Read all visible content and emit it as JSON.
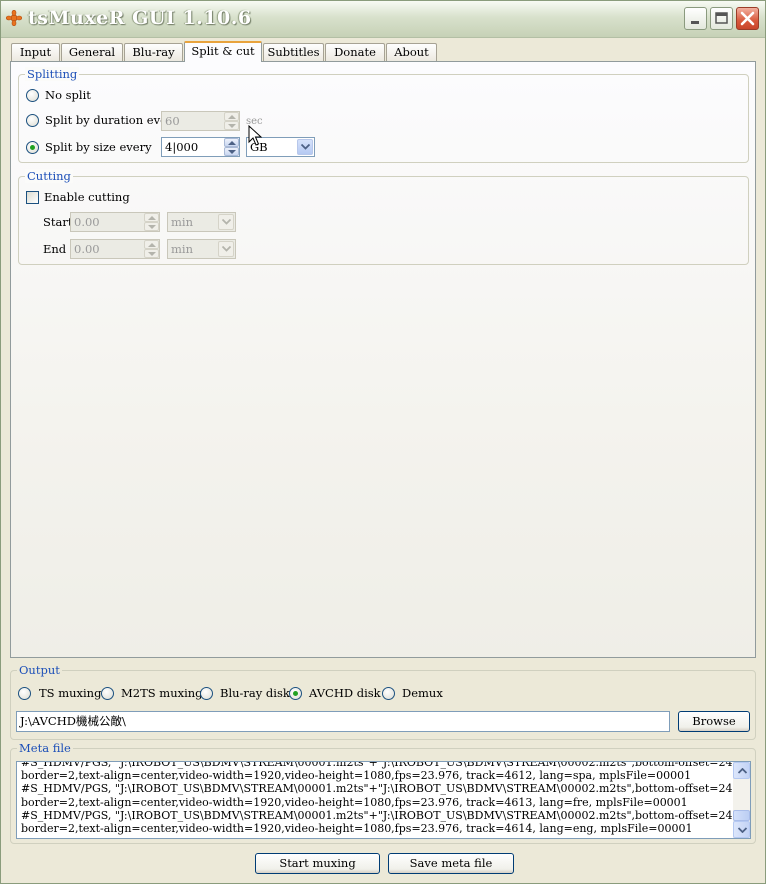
{
  "window": {
    "title": "tsMuxeR GUI 1.10.6",
    "controls": [
      "minimize-icon",
      "maximize-icon",
      "close-icon"
    ]
  },
  "tabs": [
    {
      "label": "Input",
      "active": false
    },
    {
      "label": "General",
      "active": false
    },
    {
      "label": "Blu-ray",
      "active": false
    },
    {
      "label": "Split & cut",
      "active": true
    },
    {
      "label": "Subtitles",
      "active": false
    },
    {
      "label": "Donate",
      "active": false
    },
    {
      "label": "About",
      "active": false
    }
  ],
  "splitting": {
    "legend": "Splitting",
    "no_split": "No split",
    "by_duration": "Split by duration every",
    "duration_value": "60",
    "duration_unit": "sec",
    "by_size": "Split by size every",
    "size_value": "4|000",
    "size_unit": "GB",
    "selected": "by_size"
  },
  "cutting": {
    "legend": "Cutting",
    "enable": "Enable cutting",
    "enabled": false,
    "start_label": "Start",
    "start_value": "0.00",
    "start_unit": "min",
    "end_label": "End",
    "end_value": "0.00",
    "end_unit": "min"
  },
  "output": {
    "legend": "Output",
    "options": [
      "TS muxing",
      "M2TS muxing",
      "Blu-ray disk",
      "AVCHD disk",
      "Demux"
    ],
    "selected": "AVCHD disk",
    "path": "J:\\AVCHD機械公敵\\",
    "browse": "Browse"
  },
  "meta": {
    "legend": "Meta file",
    "text": "#S_HDMV/PGS, \"J:\\IROBOT_US\\BDMV\\STREAM\\00001.m2ts\"+\"J:\\IROBOT_US\\BDMV\\STREAM\\00002.m2ts\",bottom-offset=24,font-\nborder=2,text-align=center,video-width=1920,video-height=1080,fps=23.976, track=4612, lang=spa, mplsFile=00001\n#S_HDMV/PGS, \"J:\\IROBOT_US\\BDMV\\STREAM\\00001.m2ts\"+\"J:\\IROBOT_US\\BDMV\\STREAM\\00002.m2ts\",bottom-offset=24,font-\nborder=2,text-align=center,video-width=1920,video-height=1080,fps=23.976, track=4613, lang=fre, mplsFile=00001\n#S_HDMV/PGS, \"J:\\IROBOT_US\\BDMV\\STREAM\\00001.m2ts\"+\"J:\\IROBOT_US\\BDMV\\STREAM\\00002.m2ts\",bottom-offset=24,font-\nborder=2,text-align=center,video-width=1920,video-height=1080,fps=23.976, track=4614, lang=eng, mplsFile=00001"
  },
  "actions": {
    "start": "Start muxing",
    "save": "Save meta file"
  }
}
